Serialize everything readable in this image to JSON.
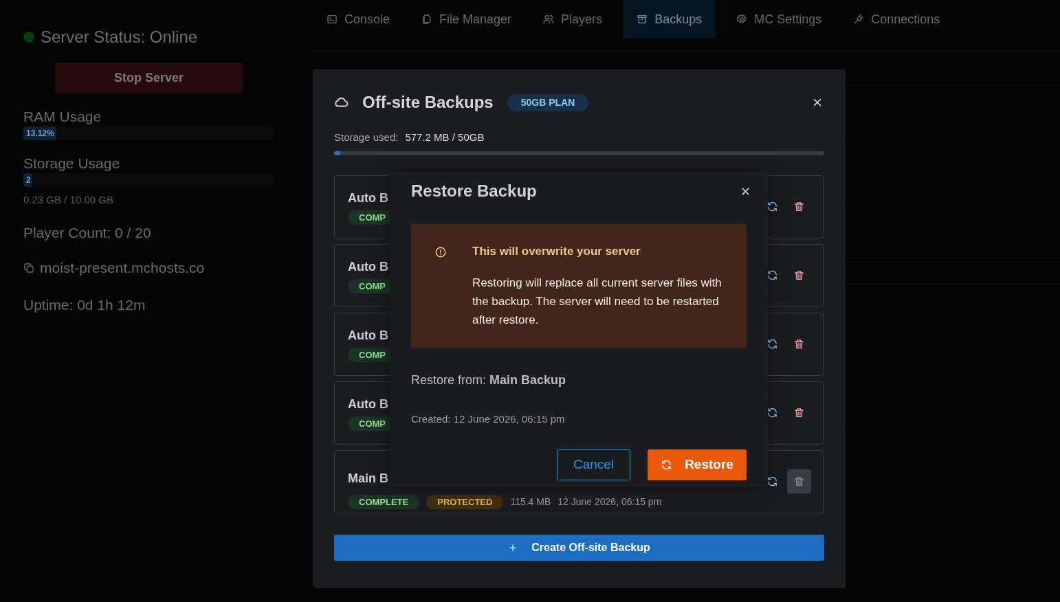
{
  "sidebar": {
    "status": {
      "label": "Server Status: Online",
      "color": "#0a3a0c"
    },
    "stop_button": "Stop Server",
    "ram": {
      "label": "RAM Usage",
      "reading": "13.12%",
      "level": 0.1312
    },
    "storage": {
      "label": "Storage Usage",
      "reading": "2",
      "level": 0.023,
      "detail": "0.23 GB / 10.00 GB"
    },
    "player_count": "Player Count: 0 / 20",
    "address": "moist-present.mchosts.co",
    "uptime": "Uptime: 0d 1h 12m"
  },
  "tabs": [
    {
      "label": "Console",
      "selected": false
    },
    {
      "label": "File Manager",
      "selected": false
    },
    {
      "label": "Players",
      "selected": false
    },
    {
      "label": "Backups",
      "selected": true
    },
    {
      "label": "MC Settings",
      "selected": false
    },
    {
      "label": "Connections",
      "selected": false
    }
  ],
  "backups_modal": {
    "title": "Off-site Backups",
    "plan_badge": "50GB PLAN",
    "storage_label": "Storage used:",
    "storage_value": "577.2 MB / 50GB",
    "storage_bar": {
      "level": 0.012
    },
    "rows": [
      {
        "name": "Auto B",
        "status": "COMP",
        "delete_disabled": false
      },
      {
        "name": "Auto B",
        "status": "COMP",
        "delete_disabled": false
      },
      {
        "name": "Auto B",
        "status": "COMP",
        "delete_disabled": false
      },
      {
        "name": "Auto B",
        "status": "COMP",
        "delete_disabled": false
      },
      {
        "name": "Main B",
        "status": "COMPLETE",
        "protected": "PROTECTED",
        "size": "115.4 MB",
        "date": "12 June 2026, 06:15 pm",
        "delete_disabled": true
      }
    ],
    "create_button": "Create Off-site Backup"
  },
  "restore_dialog": {
    "title": "Restore Backup",
    "warning": {
      "title": "This will overwrite your server",
      "body": "Restoring will replace all current server files with the backup. The server will need to be restarted after restore."
    },
    "source": "Restore from: **Main Backup**",
    "created": "Created: 12 June 2026, 06:15 pm",
    "cancel_button": "Cancel",
    "confirm_button": "Restore"
  }
}
